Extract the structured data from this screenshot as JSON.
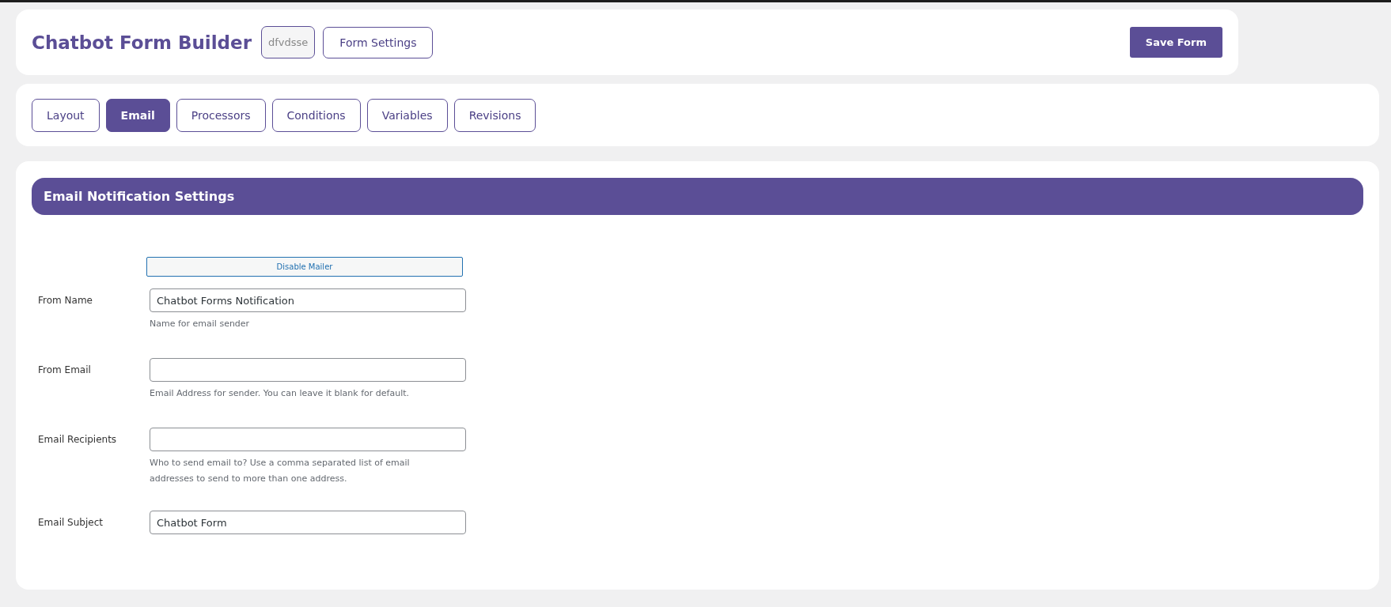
{
  "header": {
    "title": "Chatbot Form Builder",
    "form_id": "dfvdsse",
    "settings_button": "Form Settings",
    "save_button": "Save Form"
  },
  "tabs": [
    {
      "label": "Layout",
      "selected": false
    },
    {
      "label": "Email",
      "selected": true
    },
    {
      "label": "Processors",
      "selected": false
    },
    {
      "label": "Conditions",
      "selected": false
    },
    {
      "label": "Variables",
      "selected": false
    },
    {
      "label": "Revisions",
      "selected": false
    }
  ],
  "panel": {
    "heading": "Email Notification Settings",
    "mailer_button": "Disable Mailer",
    "fields": [
      {
        "label": "From Name",
        "value": "Chatbot Forms Notification",
        "help": "Name for email sender"
      },
      {
        "label": "From Email",
        "help": "Email Address for sender. You can leave it blank for default."
      },
      {
        "label": "Email Recipients",
        "help": "Who to send email to? Use a comma separated list of email addresses to send to more than one address."
      },
      {
        "label": "Email Subject",
        "value": "Chatbot Form"
      }
    ]
  }
}
